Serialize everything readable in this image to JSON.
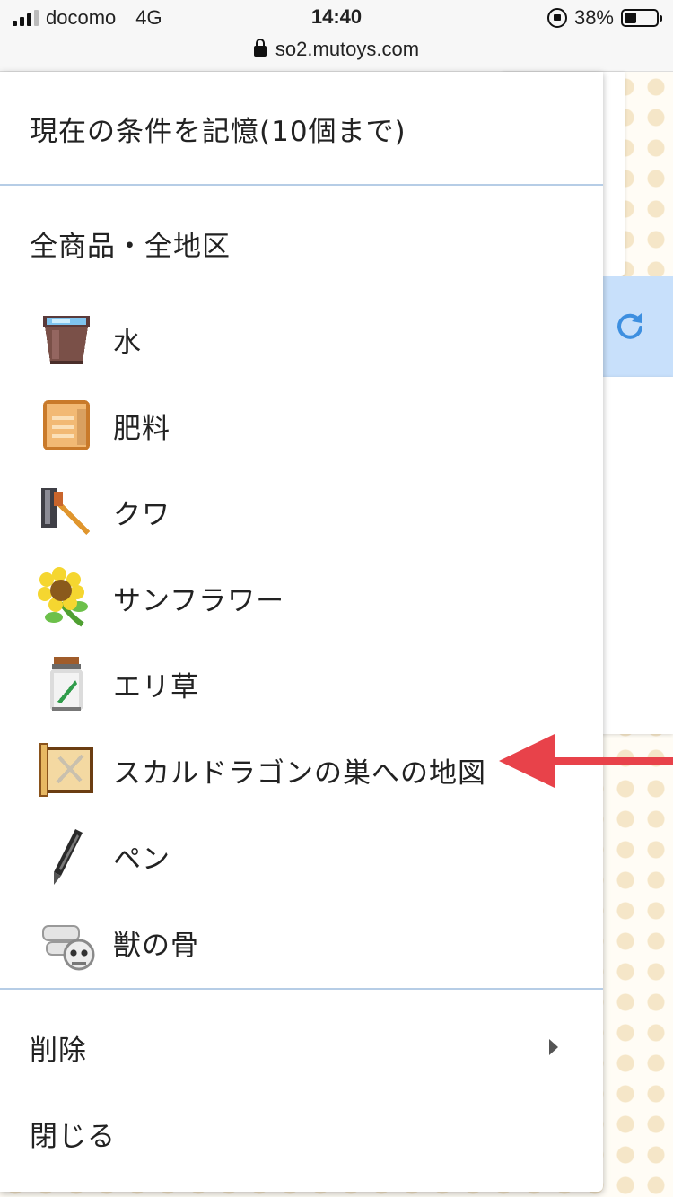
{
  "status_bar": {
    "carrier": "docomo",
    "network": "4G",
    "time": "14:40",
    "battery_percent": "38%"
  },
  "url_bar": {
    "domain": "so2.mutoys.com"
  },
  "menu": {
    "save_condition_label": "現在の条件を記憶(10個まで)",
    "all_label": "全商品・全地区",
    "items": [
      {
        "label": "水",
        "icon": "water-bucket-icon"
      },
      {
        "label": "肥料",
        "icon": "fertilizer-sack-icon"
      },
      {
        "label": "クワ",
        "icon": "hoe-icon"
      },
      {
        "label": "サンフラワー",
        "icon": "sunflower-icon"
      },
      {
        "label": "エリ草",
        "icon": "herb-jar-icon"
      },
      {
        "label": "スカルドラゴンの巣への地図",
        "icon": "map-scroll-icon"
      },
      {
        "label": "ペン",
        "icon": "pen-icon"
      },
      {
        "label": "獣の骨",
        "icon": "beast-bone-icon"
      }
    ],
    "delete_label": "削除",
    "close_label": "閉じる"
  },
  "colors": {
    "accent_blue": "#3d8fe0",
    "divider": "#b6cde6",
    "annotation_arrow": "#e8424a"
  }
}
